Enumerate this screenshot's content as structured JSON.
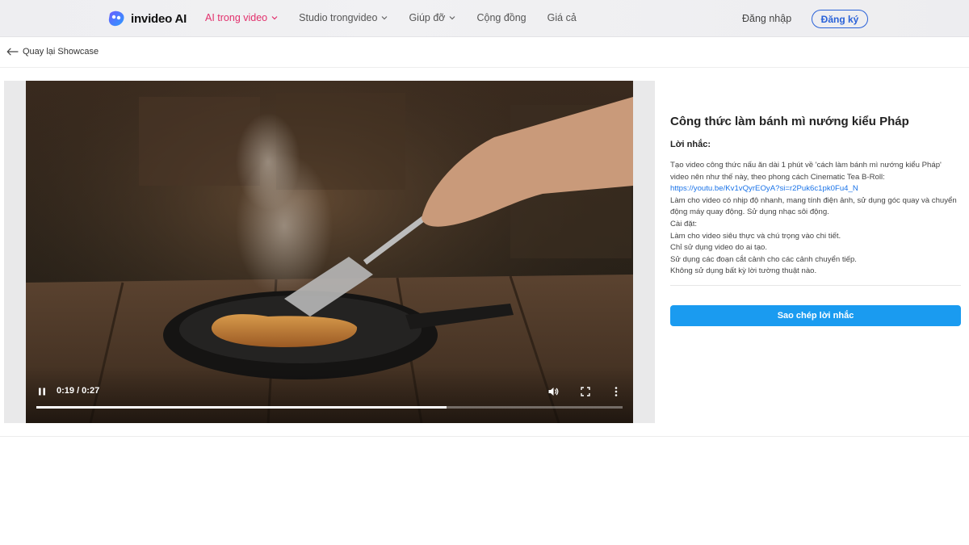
{
  "header": {
    "logo_text": "invideo AI",
    "nav": [
      {
        "label": "AI trong video",
        "active": true,
        "has_dropdown": true
      },
      {
        "label": "Studio trongvideo",
        "active": false,
        "has_dropdown": true
      },
      {
        "label": "Giúp đỡ",
        "active": false,
        "has_dropdown": true
      },
      {
        "label": "Cộng đồng",
        "active": false,
        "has_dropdown": false
      },
      {
        "label": "Giá cả",
        "active": false,
        "has_dropdown": false
      }
    ],
    "login_label": "Đăng nhập",
    "signup_label": "Đăng ký"
  },
  "back": {
    "label": "Quay lại Showcase",
    "icon": "arrow-left-icon"
  },
  "video": {
    "time_current": "0:19",
    "time_total": "0:27",
    "time_display": "0:19 / 0:27",
    "progress_fraction": 0.7,
    "state": "playing",
    "controls": [
      "pause-icon",
      "volume-icon",
      "fullscreen-icon",
      "more-vertical-icon"
    ]
  },
  "details": {
    "title": "Công thức làm bánh mì nướng kiểu Pháp",
    "prompt_label": "Lời nhắc:",
    "prompt_intro": "Tạo video công thức nấu ăn dài 1 phút về 'cách làm bánh mì nướng kiểu Pháp' video nên như thế này, theo phong cách Cinematic Tea B-Roll:",
    "prompt_link": "https://youtu.be/Kv1vQyrEOyA?si=r2Puk6c1pk0Fu4_N",
    "prompt_lines": [
      "Làm cho video có nhịp độ nhanh, mang tính điện ảnh, sử dụng góc quay và chuyển động máy quay động. Sử dụng nhạc sôi động.",
      "Cài đặt:",
      "Làm cho video siêu thực và chú trọng vào chi tiết.",
      "Chỉ sử dụng video do ai tạo.",
      "Sử dụng các đoạn cắt cảnh cho các cảnh chuyển tiếp.",
      "Không sử dụng bất kỳ lời tường thuật nào."
    ],
    "copy_button_label": "Sao chép lời nhắc"
  },
  "colors": {
    "accent_nav": "#e2306c",
    "signup_border": "#2a62d8",
    "copy_button": "#1a9bf0",
    "link": "#1a73e8"
  }
}
